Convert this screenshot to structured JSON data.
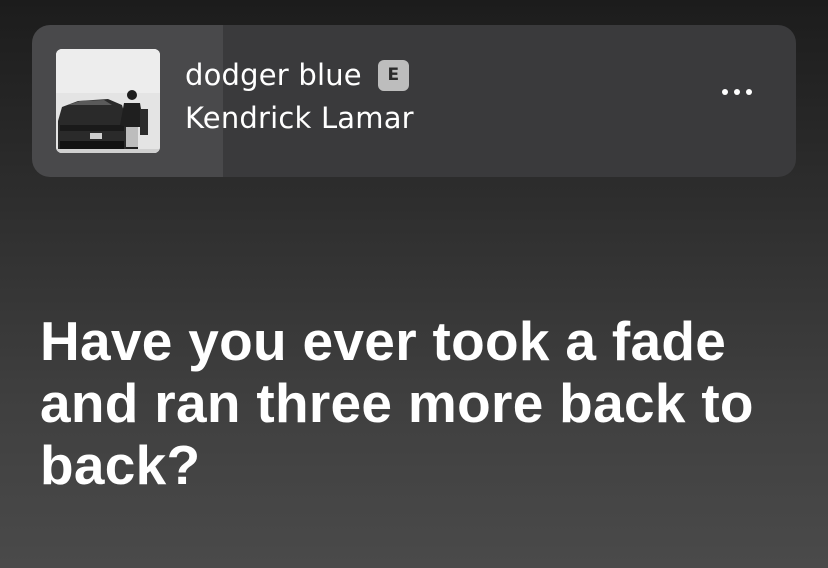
{
  "now_playing": {
    "title": "dodger blue",
    "explicit_badge": "E",
    "artist": "Kendrick Lamar",
    "album_art_icon": "album-cover-man-leaning-on-car",
    "progress_fraction": 0.25,
    "more_icon": "ellipsis-horizontal-icon"
  },
  "lyrics": {
    "current_line": "Have you ever took a fade and ran three more back to back?"
  },
  "colors": {
    "card_bg": "#3a3a3c",
    "badge_bg": "#bdbdbd",
    "text": "#ffffff"
  }
}
